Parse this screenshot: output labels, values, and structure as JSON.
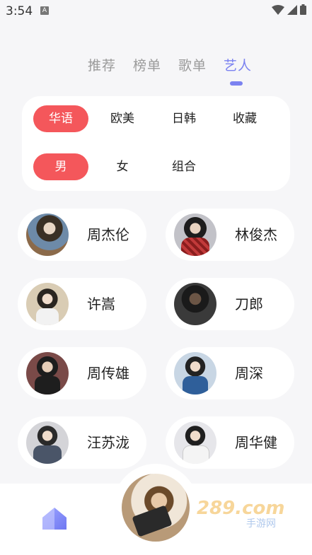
{
  "status_bar": {
    "time": "3:54",
    "notification_badge": "A",
    "icons": [
      "wifi-icon",
      "signal-icon",
      "battery-icon"
    ]
  },
  "tabs": [
    {
      "label": "推荐",
      "active": false
    },
    {
      "label": "榜单",
      "active": false
    },
    {
      "label": "歌单",
      "active": false
    },
    {
      "label": "艺人",
      "active": true
    }
  ],
  "filters": {
    "region": [
      {
        "label": "华语",
        "selected": true
      },
      {
        "label": "欧美",
        "selected": false
      },
      {
        "label": "日韩",
        "selected": false
      },
      {
        "label": "收藏",
        "selected": false
      }
    ],
    "type": [
      {
        "label": "男",
        "selected": true
      },
      {
        "label": "女",
        "selected": false
      },
      {
        "label": "组合",
        "selected": false
      }
    ]
  },
  "artists": [
    {
      "name": "周杰伦"
    },
    {
      "name": "林俊杰"
    },
    {
      "name": "许嵩"
    },
    {
      "name": "刀郎"
    },
    {
      "name": "周传雄"
    },
    {
      "name": "周深"
    },
    {
      "name": "汪苏泷"
    },
    {
      "name": "周华健"
    }
  ],
  "bottom_nav": {
    "home_icon": "home-icon",
    "now_playing": "album-cover"
  },
  "watermark": {
    "text": "289.com",
    "subtext": "手游网"
  },
  "colors": {
    "accent": "#7b82f0",
    "chip_selected": "#f4575b",
    "background": "#f6f6f8"
  }
}
